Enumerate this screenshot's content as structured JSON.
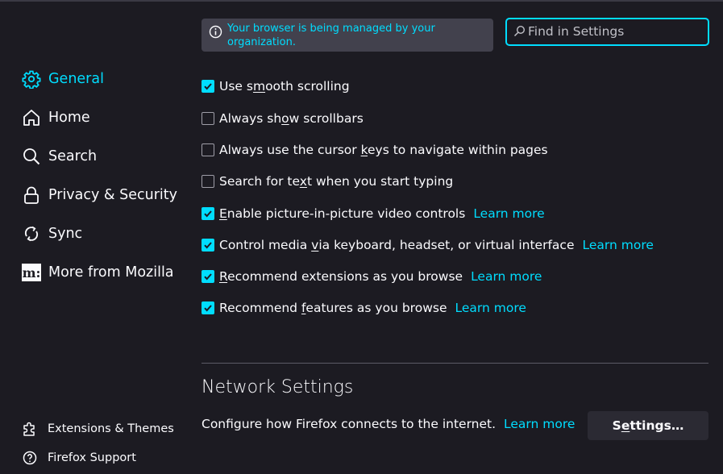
{
  "sidebar": {
    "items": [
      {
        "label": "General",
        "icon": "gear-icon",
        "selected": true
      },
      {
        "label": "Home",
        "icon": "home-icon"
      },
      {
        "label": "Search",
        "icon": "search-icon"
      },
      {
        "label": "Privacy & Security",
        "icon": "lock-icon"
      },
      {
        "label": "Sync",
        "icon": "sync-icon"
      },
      {
        "label": "More from Mozilla",
        "icon": "mozilla-logo-icon"
      }
    ],
    "footer": [
      {
        "label": "Extensions & Themes",
        "icon": "puzzle-icon"
      },
      {
        "label": "Firefox Support",
        "icon": "help-icon"
      }
    ]
  },
  "banner": {
    "text": "Your browser is being managed by your organization.",
    "icon": "info-icon"
  },
  "search": {
    "placeholder": "Find in Settings",
    "value": "",
    "icon": "search-icon"
  },
  "options": [
    {
      "pre": "Use s",
      "u": "m",
      "post": "ooth scrolling",
      "checked": true
    },
    {
      "pre": "Always sh",
      "u": "o",
      "post": "w scrollbars",
      "checked": false
    },
    {
      "pre": "Always use the cursor ",
      "u": "k",
      "post": "eys to navigate within pages",
      "checked": false
    },
    {
      "pre": "Search for te",
      "u": "x",
      "post": "t when you start typing",
      "checked": false
    },
    {
      "pre": "",
      "u": "E",
      "post": "nable picture-in-picture video controls",
      "checked": true,
      "link": "Learn more"
    },
    {
      "pre": "Control media ",
      "u": "v",
      "post": "ia keyboard, headset, or virtual interface",
      "checked": true,
      "link": "Learn more"
    },
    {
      "pre": "",
      "u": "R",
      "post": "ecommend extensions as you browse",
      "checked": true,
      "link": "Learn more"
    },
    {
      "pre": "Recommend ",
      "u": "f",
      "post": "eatures as you browse",
      "checked": true,
      "link": "Learn more"
    }
  ],
  "network": {
    "title": "Network Settings",
    "description": "Configure how Firefox connects to the internet.",
    "link": "Learn more",
    "button": {
      "pre": "S",
      "u": "e",
      "post": "ttings…"
    }
  },
  "colors": {
    "accent": "#00ddff",
    "background": "#1c1b22",
    "banner": "#42414d",
    "button": "#2b2a33"
  }
}
